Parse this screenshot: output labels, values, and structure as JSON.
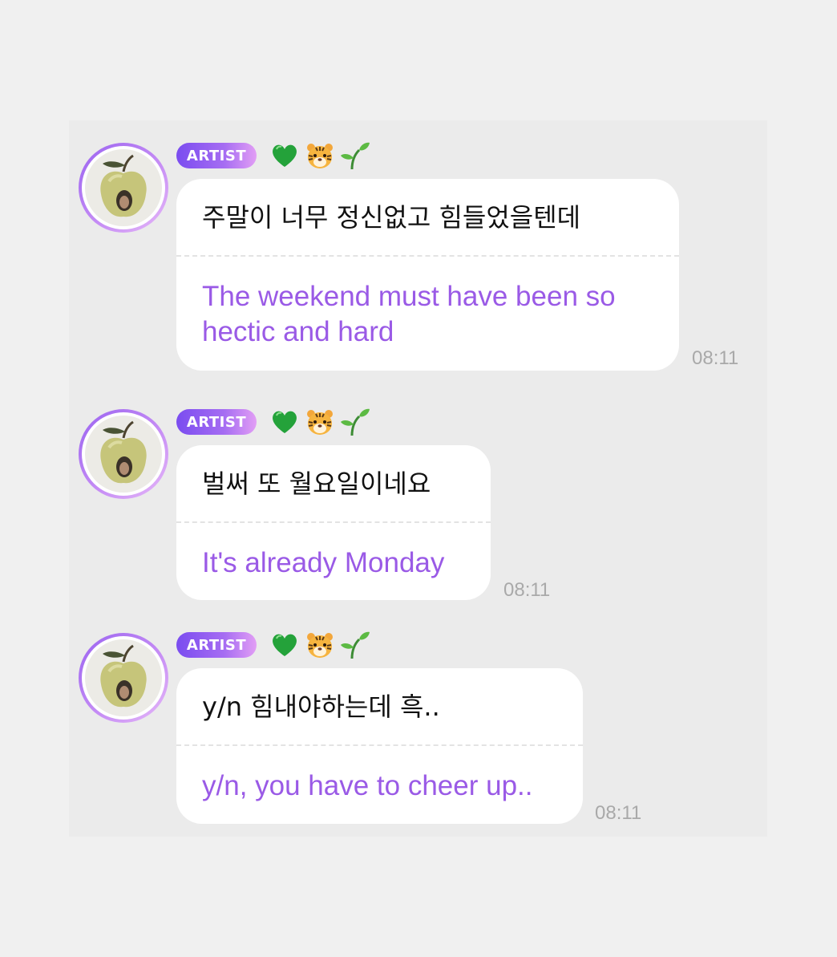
{
  "messages": [
    {
      "badge": "ARTIST",
      "badge_emojis": [
        "green-heart",
        "tiger-face",
        "seedling"
      ],
      "korean": "주말이 너무 정신없고 힘들었을텐데",
      "translation": "The weekend must have been so hectic and hard",
      "time": "08:11"
    },
    {
      "badge": "ARTIST",
      "badge_emojis": [
        "green-heart",
        "tiger-face",
        "seedling"
      ],
      "korean": "벌써 또 월요일이네요",
      "translation": "It's already Monday",
      "time": "08:11"
    },
    {
      "badge": "ARTIST",
      "badge_emojis": [
        "green-heart",
        "tiger-face",
        "seedling"
      ],
      "korean": "y/n 힘내야하는데 흑..",
      "translation": "y/n, you have to cheer up..",
      "time": "08:11"
    }
  ],
  "colors": {
    "page_background": "#f0f0f0",
    "panel_background": "#ebebeb",
    "bubble_background": "#ffffff",
    "translation_text": "#9a5ae6",
    "badge_gradient_start": "#7a4cf0",
    "badge_gradient_end": "#e29ef5",
    "timestamp_text": "#a9a9a9"
  }
}
